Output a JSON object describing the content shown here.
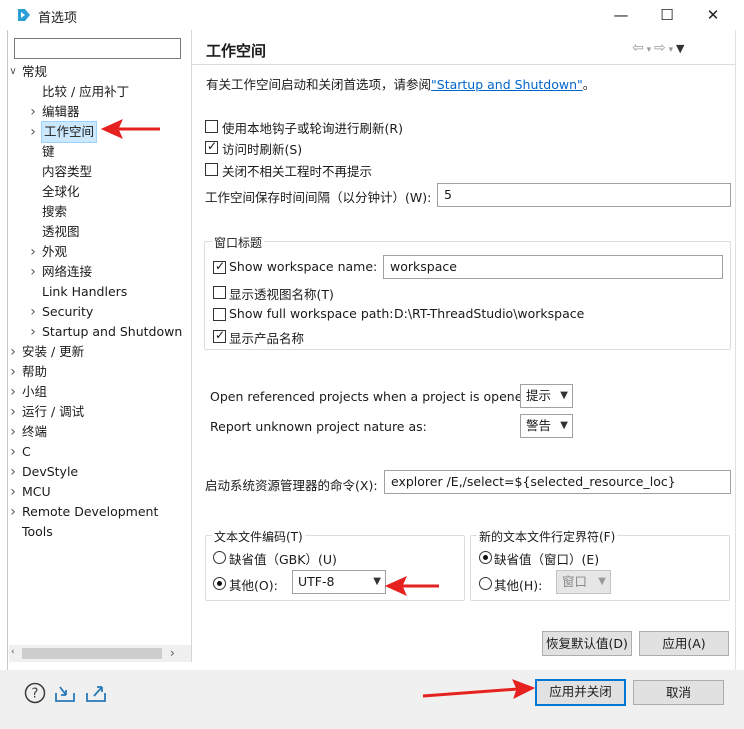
{
  "window": {
    "title": "首选项",
    "minimize": "—",
    "maximize": "☐",
    "close": "✕"
  },
  "left": {
    "filter_value": "",
    "tree": [
      {
        "label": "常规",
        "level": 0,
        "twisty": "open"
      },
      {
        "label": "比较 / 应用补丁",
        "level": 1,
        "twisty": "none"
      },
      {
        "label": "编辑器",
        "level": 1,
        "twisty": "closed"
      },
      {
        "label": "工作空间",
        "level": 1,
        "twisty": "closed",
        "selected": true
      },
      {
        "label": "键",
        "level": 1,
        "twisty": "none"
      },
      {
        "label": "内容类型",
        "level": 1,
        "twisty": "none"
      },
      {
        "label": "全球化",
        "level": 1,
        "twisty": "none"
      },
      {
        "label": "搜索",
        "level": 1,
        "twisty": "none"
      },
      {
        "label": "透视图",
        "level": 1,
        "twisty": "none"
      },
      {
        "label": "外观",
        "level": 1,
        "twisty": "closed"
      },
      {
        "label": "网络连接",
        "level": 1,
        "twisty": "closed"
      },
      {
        "label": "Link Handlers",
        "level": 1,
        "twisty": "none"
      },
      {
        "label": "Security",
        "level": 1,
        "twisty": "closed"
      },
      {
        "label": "Startup and Shutdown",
        "level": 1,
        "twisty": "closed"
      },
      {
        "label": "安装 / 更新",
        "level": 0,
        "twisty": "closed"
      },
      {
        "label": "帮助",
        "level": 0,
        "twisty": "closed"
      },
      {
        "label": "小组",
        "level": 0,
        "twisty": "closed"
      },
      {
        "label": "运行 / 调试",
        "level": 0,
        "twisty": "closed"
      },
      {
        "label": "终端",
        "level": 0,
        "twisty": "closed"
      },
      {
        "label": "C",
        "level": 0,
        "twisty": "closed"
      },
      {
        "label": "DevStyle",
        "level": 0,
        "twisty": "closed"
      },
      {
        "label": "MCU",
        "level": 0,
        "twisty": "closed"
      },
      {
        "label": "Remote Development",
        "level": 0,
        "twisty": "closed"
      },
      {
        "label": "Tools",
        "level": 0,
        "twisty": "none"
      }
    ]
  },
  "page": {
    "title": "工作空间",
    "intro_prefix": "有关工作空间启动和关闭首选项，请参阅",
    "intro_link": "\"Startup and Shutdown\"",
    "intro_suffix": "。",
    "refresh_native": {
      "label": "使用本地钩子或轮询进行刷新(R)",
      "checked": false
    },
    "refresh_access": {
      "label": "访问时刷新(S)",
      "checked": true
    },
    "close_unrelated": {
      "label": "关闭不相关工程时不再提示",
      "checked": false
    },
    "save_interval_label": "工作空间保存时间间隔（以分钟计）(W):",
    "save_interval_value": "5",
    "window_title_group": {
      "title": "窗口标题",
      "show_ws_name": {
        "label": "Show workspace name:",
        "checked": true,
        "value": "workspace"
      },
      "show_perspective": {
        "label": "显示透视图名称(T)",
        "checked": false
      },
      "show_full_path": {
        "label": "Show full workspace path:",
        "checked": false,
        "value": "D:\\RT-ThreadStudio\\workspace"
      },
      "show_product": {
        "label": "显示产品名称",
        "checked": true
      }
    },
    "open_referenced": {
      "label": "Open referenced projects when a project is opened:",
      "value": "提示"
    },
    "report_unknown": {
      "label": "Report unknown project nature as:",
      "value": "警告"
    },
    "explorer_cmd": {
      "label": "启动系统资源管理器的命令(X):",
      "value": "explorer /E,/select=${selected_resource_loc}"
    },
    "encoding_group": {
      "title": "文本文件编码(T)",
      "default_label": "缺省值（GBK）(U)",
      "other_label": "其他(O):",
      "other_value": "UTF-8",
      "selected": "other"
    },
    "delimiter_group": {
      "title": "新的文本文件行定界符(F)",
      "default_label": "缺省值（窗口）(E)",
      "other_label": "其他(H):",
      "other_value": "窗口",
      "selected": "default"
    },
    "restore_defaults": "恢复默认值(D)",
    "apply": "应用(A)"
  },
  "footer": {
    "apply_close": "应用并关闭",
    "cancel": "取消"
  },
  "annotation_color": "#e5221f"
}
